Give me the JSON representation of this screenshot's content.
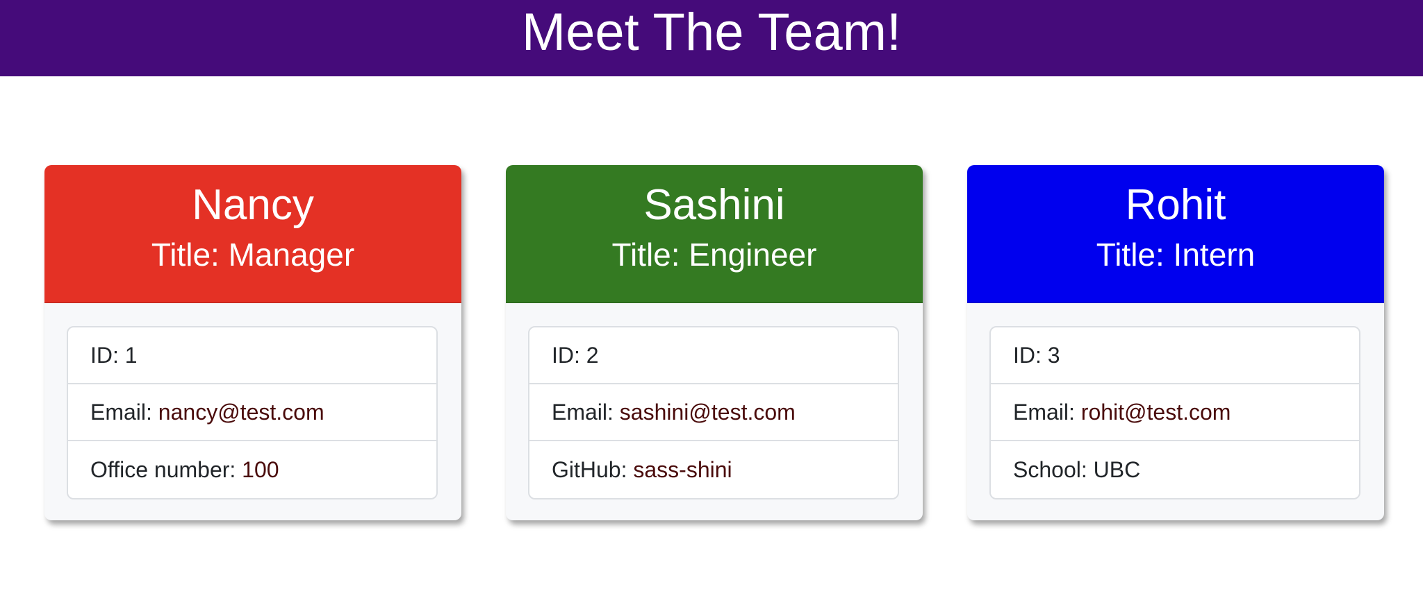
{
  "header": {
    "title": "Meet The Team!",
    "background": "#450b7a"
  },
  "cards": [
    {
      "name": "Nancy",
      "title": "Title: Manager",
      "color": "#e43125",
      "id_label": "ID: ",
      "id_value": "1",
      "email_label": "Email: ",
      "email_value": "nancy@test.com",
      "extra_label": "Office number: ",
      "extra_value": "100"
    },
    {
      "name": "Sashini",
      "title": "Title: Engineer",
      "color": "#347a22",
      "id_label": "ID: ",
      "id_value": "2",
      "email_label": "Email: ",
      "email_value": "sashini@test.com",
      "extra_label": "GitHub: ",
      "extra_value": "sass-shini"
    },
    {
      "name": "Rohit",
      "title": "Title: Intern",
      "color": "#0000ee",
      "id_label": "ID: ",
      "id_value": "3",
      "email_label": "Email: ",
      "email_value": "rohit@test.com",
      "extra_label": "School: ",
      "extra_value": "UBC"
    }
  ]
}
